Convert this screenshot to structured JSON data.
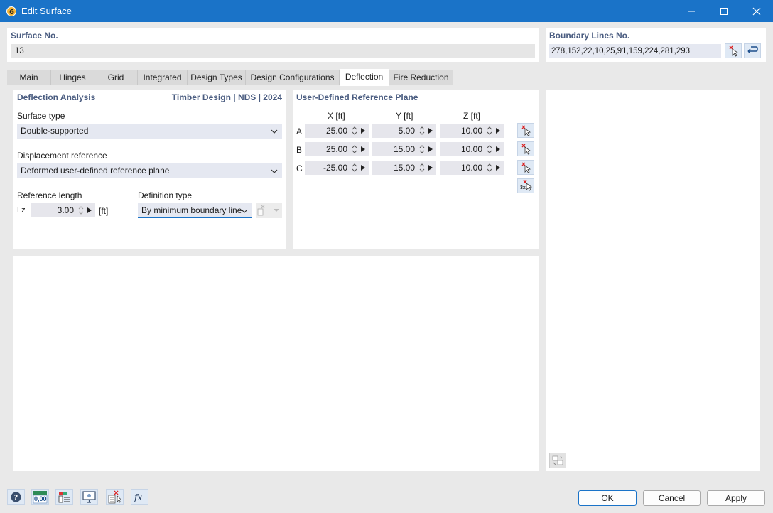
{
  "window": {
    "title": "Edit Surface"
  },
  "surface": {
    "label": "Surface No.",
    "value": "13"
  },
  "boundary": {
    "label": "Boundary Lines No.",
    "value": "278,152,22,10,25,91,159,224,281,293"
  },
  "tabs": [
    "Main",
    "Hinges",
    "Grid",
    "Integrated",
    "Design Types",
    "Design Configurations",
    "Deflection",
    "Fire Reduction"
  ],
  "active_tab": "Deflection",
  "deflection": {
    "title": "Deflection Analysis",
    "standard": "Timber Design | NDS | 2024",
    "surface_type_label": "Surface type",
    "surface_type_value": "Double-supported",
    "displacement_label": "Displacement reference",
    "displacement_value": "Deformed user-defined reference plane",
    "ref_length_label": "Reference length",
    "lz_symbol": "Lz",
    "lz_value": "3.00",
    "lz_unit": "[ft]",
    "definition_label": "Definition type",
    "definition_value": "By minimum boundary line"
  },
  "refplane": {
    "title": "User-Defined Reference Plane",
    "headers": [
      "X [ft]",
      "Y [ft]",
      "Z [ft]"
    ],
    "rows": [
      {
        "label": "A",
        "x": "25.00",
        "y": "5.00",
        "z": "10.00"
      },
      {
        "label": "B",
        "x": "25.00",
        "y": "15.00",
        "z": "10.00"
      },
      {
        "label": "C",
        "x": "-25.00",
        "y": "15.00",
        "z": "10.00"
      }
    ],
    "pick3_label": "3x"
  },
  "footer": {
    "ok": "OK",
    "cancel": "Cancel",
    "apply": "Apply",
    "numbers_label": "0,00"
  },
  "colors": {
    "titlebar": "#1a73c8",
    "section_title": "#4a5c80",
    "field_bg": "#e5e8f1"
  }
}
